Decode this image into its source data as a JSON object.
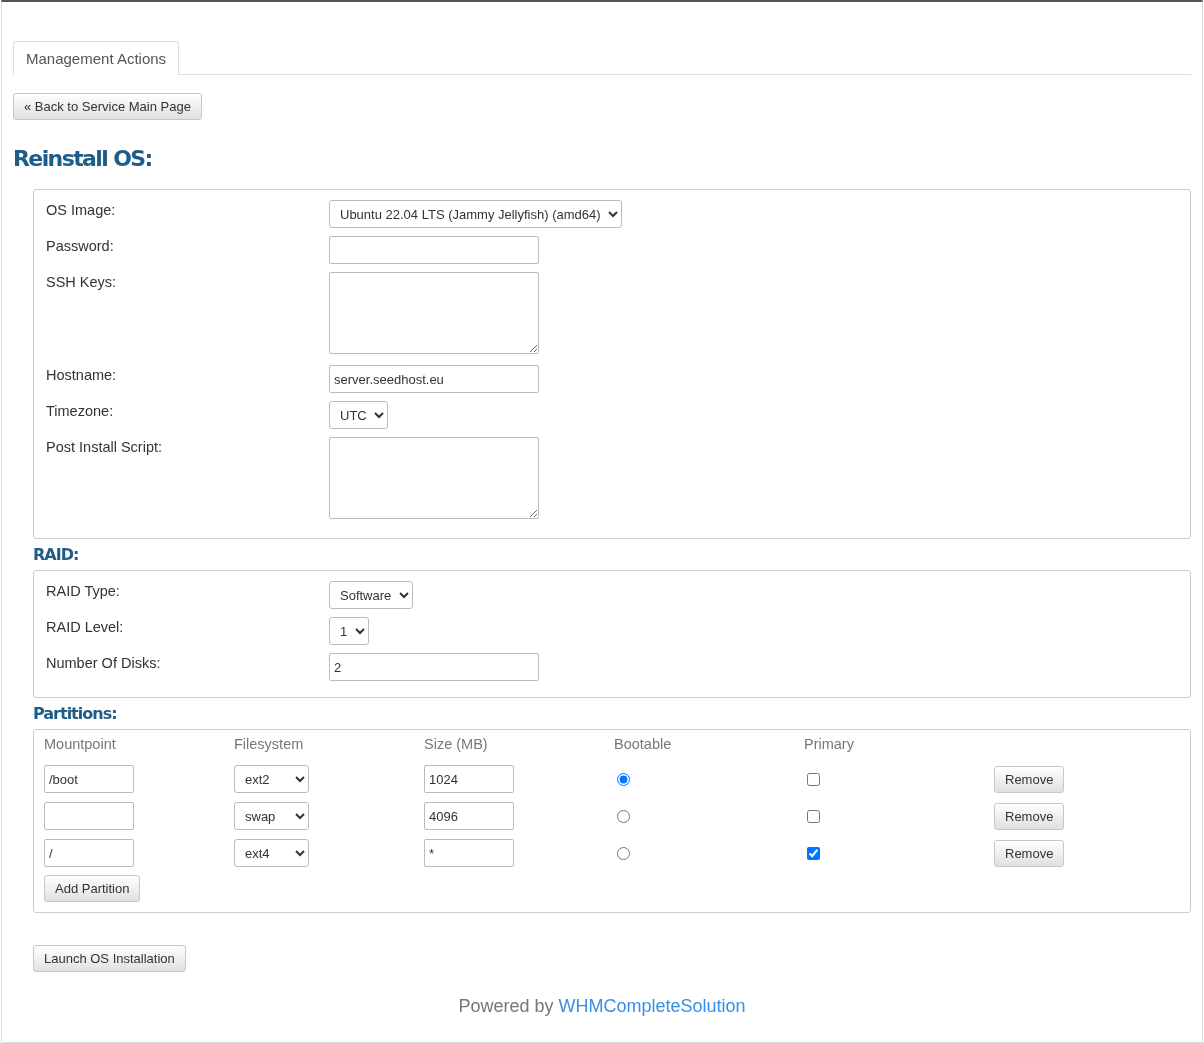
{
  "tabs": [
    {
      "label": "Management Actions",
      "selected": true
    }
  ],
  "back_button": "« Back to Service Main Page",
  "title": "Reinstall OS:",
  "os_fields": [
    {
      "kind": "select",
      "label": "OS Image:",
      "value": "Ubuntu 22.04 LTS (Jammy Jellyfish) (amd64)"
    },
    {
      "kind": "text",
      "label": "Password:"
    },
    {
      "kind": "textarea",
      "label": "SSH Keys:"
    },
    {
      "kind": "text",
      "label": "Hostname:",
      "value": "server.seedhost.eu"
    },
    {
      "kind": "select",
      "label": "Timezone:",
      "value": "UTC"
    },
    {
      "kind": "textarea",
      "label": "Post Install Script:"
    }
  ],
  "raid": {
    "title": "RAID:",
    "fields": [
      {
        "kind": "select",
        "label": "RAID Type:",
        "value": "Software"
      },
      {
        "kind": "select",
        "label": "RAID Level:",
        "value": "1"
      },
      {
        "kind": "text",
        "label": "Number Of Disks:",
        "value": "2"
      }
    ]
  },
  "partitions": {
    "title": "Partitions:",
    "columns": [
      "Mountpoint",
      "Filesystem",
      "Size (MB)",
      "Bootable",
      "Primary"
    ],
    "rows": [
      {
        "mountpoint": "/boot",
        "filesystem": "ext2",
        "size": "1024",
        "bootable": true,
        "primary": false,
        "remove": "Remove"
      },
      {
        "filesystem": "swap",
        "size": "4096",
        "bootable": false,
        "primary": false,
        "remove": "Remove"
      },
      {
        "mountpoint": "/",
        "filesystem": "ext4",
        "size": "*",
        "bootable": false,
        "primary": true,
        "remove": "Remove"
      }
    ],
    "add_button": "Add Partition"
  },
  "launch_button": "Launch OS Installation",
  "footer": {
    "text": "Powered by",
    "link": "WHMCompleteSolution"
  }
}
